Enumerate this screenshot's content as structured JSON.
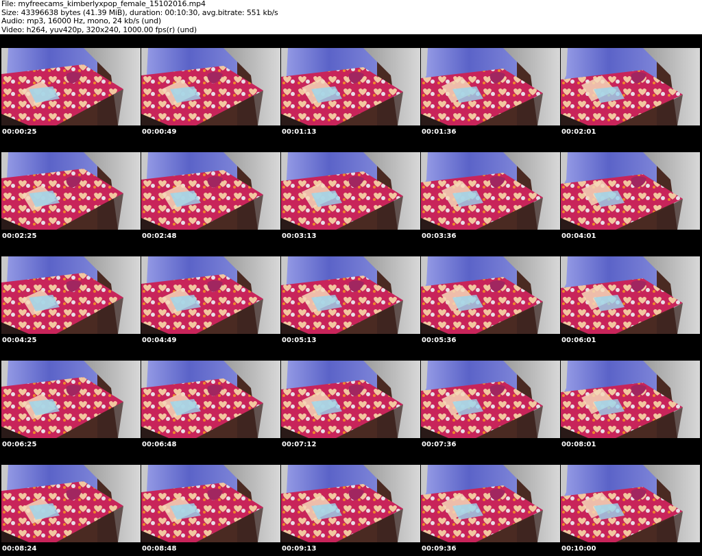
{
  "header": {
    "file": "File: myfreecams_kimberlyxpop_female_15102016.mp4",
    "size": "Size: 43396638 bytes (41.39 MiB), duration: 00:10:30, avg.bitrate: 551 kb/s",
    "audio": "Audio: mp3, 16000 Hz, mono, 24 kb/s (und)",
    "video": "Video: h264, yuv420p, 320x240, 1000.00 fps(r) (und)"
  },
  "thumbnails": [
    "00:00:25",
    "00:00:49",
    "00:01:13",
    "00:01:36",
    "00:02:01",
    "00:02:25",
    "00:02:48",
    "00:03:13",
    "00:03:36",
    "00:04:01",
    "00:04:25",
    "00:04:49",
    "00:05:13",
    "00:05:36",
    "00:06:01",
    "00:06:25",
    "00:06:48",
    "00:07:12",
    "00:07:36",
    "00:08:01",
    "00:08:24",
    "00:08:48",
    "00:09:13",
    "00:09:36",
    "00:10:00"
  ],
  "colors": {
    "background": "#000000",
    "wall_blue": "#5b63c8",
    "bedsheet_pink": "#c8245a",
    "floor_brown": "#4a2a22"
  }
}
